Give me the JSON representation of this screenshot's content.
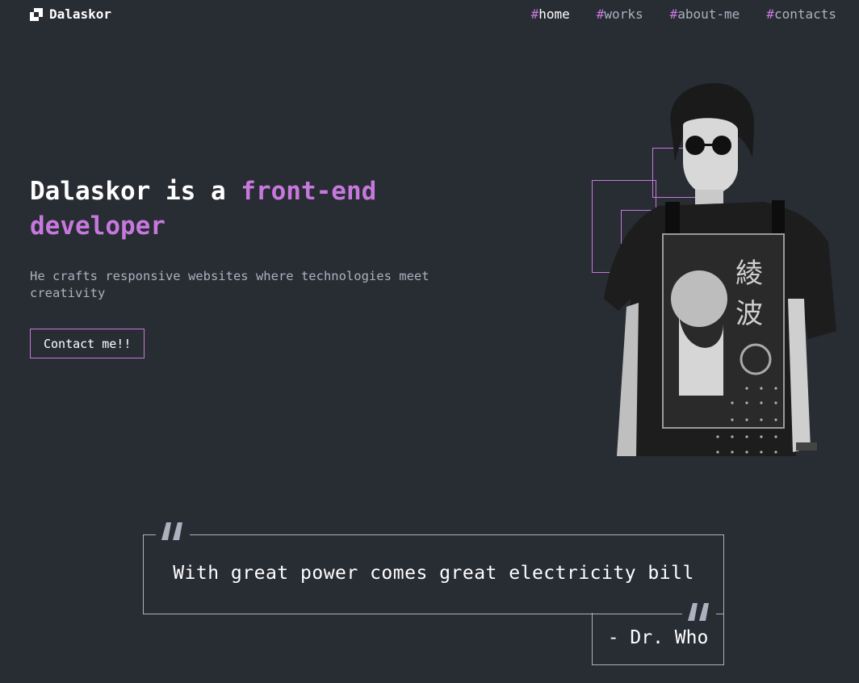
{
  "header": {
    "brand": "Dalaskor",
    "nav": [
      {
        "hash": "#",
        "label": "home",
        "active": true
      },
      {
        "hash": "#",
        "label": "works",
        "active": false
      },
      {
        "hash": "#",
        "label": "about-me",
        "active": false
      },
      {
        "hash": "#",
        "label": "contacts",
        "active": false
      }
    ]
  },
  "hero": {
    "title_part1": "Dalaskor is a ",
    "title_accent1": "front-end",
    "title_accent2": "developer",
    "subtitle": "He crafts responsive websites where technologies meet creativity",
    "cta_label": "Contact me!!",
    "image_icon": "person-photo"
  },
  "quote": {
    "text": "With great power comes great electricity bill",
    "author": "- Dr. Who",
    "open_icon": "quote-icon",
    "close_icon": "quote-icon"
  },
  "colors": {
    "background": "#282c33",
    "accent": "#c778dd",
    "muted": "#abb2bf",
    "text": "#ffffff"
  }
}
